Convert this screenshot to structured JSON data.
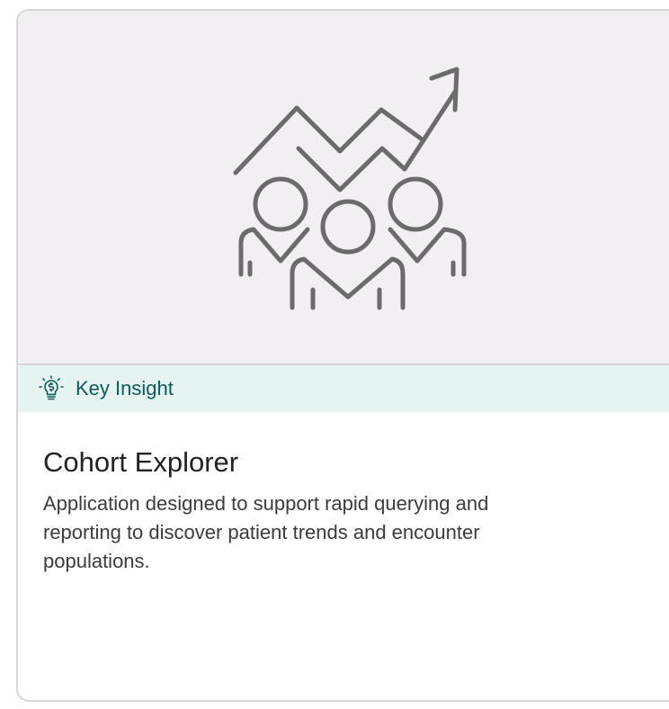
{
  "card": {
    "hero_icon": "trend-growth-people-icon",
    "badge": {
      "icon": "lightbulb-icon",
      "label": "Key Insight"
    },
    "title": "Cohort Explorer",
    "description": "Application designed to support rapid querying and reporting to discover patient trends and encounter populations."
  },
  "colors": {
    "hero_bg": "#f1eff2",
    "badge_bg": "#e5f4f1",
    "badge_text": "#0d5a5a",
    "icon_stroke": "#6b6b6b"
  }
}
